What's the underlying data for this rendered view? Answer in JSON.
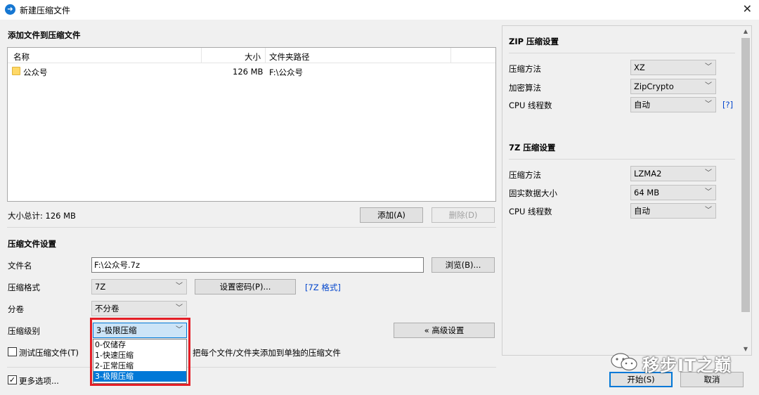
{
  "window": {
    "title": "新建压缩文件",
    "close": "✕"
  },
  "add_files": {
    "section_title": "添加文件到压缩文件",
    "columns": {
      "name": "名称",
      "size": "大小",
      "path": "文件夹路径"
    },
    "rows": [
      {
        "name": "公众号",
        "size": "126 MB",
        "path": "F:\\公众号"
      }
    ],
    "total_size": "大小总计: 126 MB",
    "add_button": "添加(A)",
    "delete_button": "删除(D)"
  },
  "archive_settings": {
    "section_title": "压缩文件设置",
    "filename_label": "文件名",
    "filename_value": "F:\\公众号.7z",
    "browse_button": "浏览(B)...",
    "format_label": "压缩格式",
    "format_value": "7Z",
    "set_password_button": "设置密码(P)...",
    "format_link": "[7Z 格式]",
    "split_label": "分卷",
    "split_value": "不分卷",
    "level_label": "压缩级别",
    "level_value": "3-极限压缩",
    "level_options": [
      "0-仅储存",
      "1-快速压缩",
      "2-正常压缩",
      "3-极限压缩"
    ],
    "level_selected_index": 3,
    "advanced_button": "« 高级设置",
    "test_checkbox_label": "测试压缩文件(T)",
    "test_checked": false,
    "separate_archive_label": "把每个文件/文件夹添加到单独的压缩文件",
    "more_options_label": "更多选项...",
    "more_options_checked": true
  },
  "zip_settings": {
    "section_title": "ZIP 压缩设置",
    "method_label": "压缩方法",
    "method_value": "XZ",
    "encryption_label": "加密算法",
    "encryption_value": "ZipCrypto",
    "cpu_label": "CPU 线程数",
    "cpu_value": "自动",
    "help_link": "[?]"
  },
  "sevenz_settings": {
    "section_title": "7Z 压缩设置",
    "method_label": "压缩方法",
    "method_value": "LZMA2",
    "dict_label": "固实数据大小",
    "dict_value": "64 MB",
    "cpu_label": "CPU 线程数",
    "cpu_value": "自动"
  },
  "footer": {
    "start_button": "开始(S)",
    "cancel_button": "取消"
  },
  "watermark": {
    "text": "移步IT之巅"
  },
  "colors": {
    "accent": "#0078d7",
    "highlight_box": "#e41e26",
    "link": "#0044cc"
  }
}
